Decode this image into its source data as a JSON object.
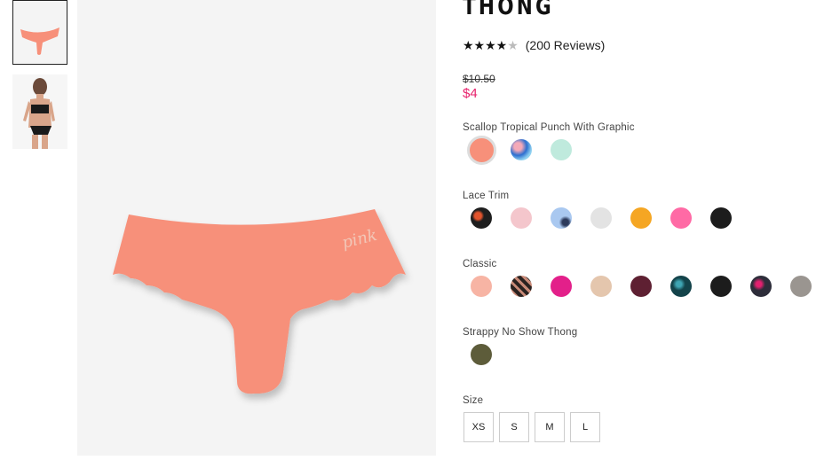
{
  "product": {
    "title": "THONG",
    "stars": "★★★★",
    "half_star": "★",
    "reviews": "(200 Reviews)",
    "price_old": "$10.50",
    "price_new": "$4",
    "logo_text": "pink"
  },
  "colors": {
    "price_sale": "#e7226c",
    "product": "#f7907a"
  },
  "variant_groups": [
    {
      "label": "Scallop Tropical Punch With Graphic"
    },
    {
      "label": "Lace Trim"
    },
    {
      "label": "Classic"
    },
    {
      "label": "Strappy No Show Thong"
    }
  ],
  "size": {
    "label": "Size",
    "options": [
      "XS",
      "S",
      "M",
      "L"
    ]
  }
}
